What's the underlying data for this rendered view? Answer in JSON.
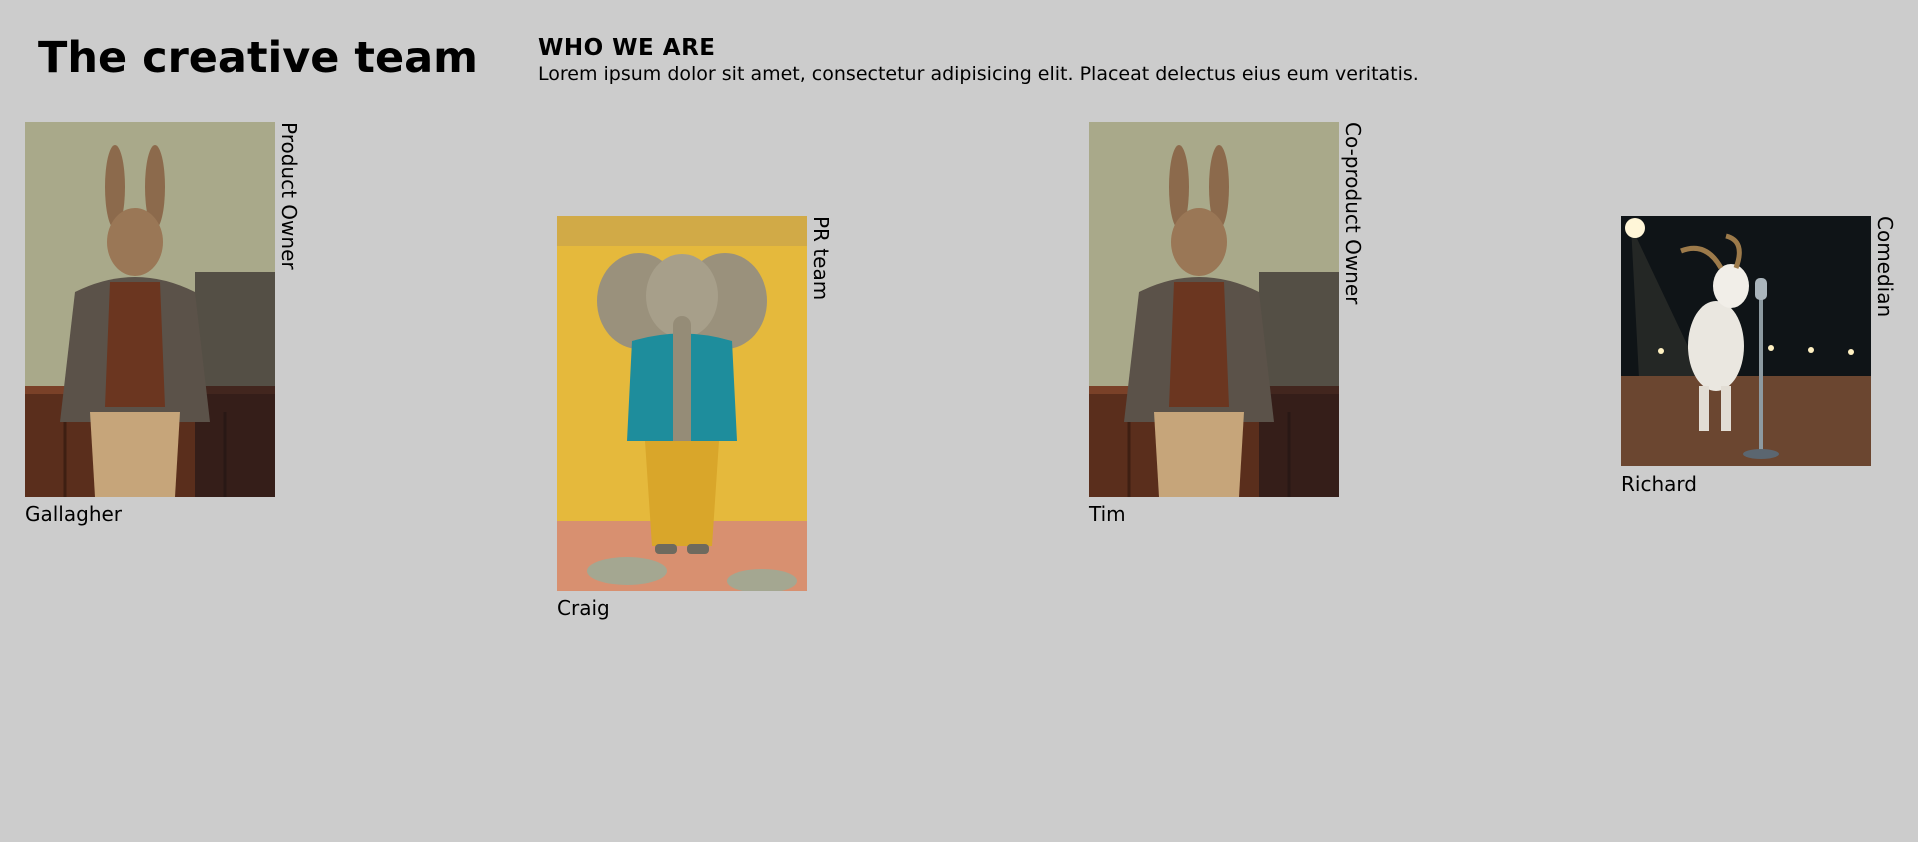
{
  "header": {
    "title": "The creative team",
    "intro_heading": "WHO WE ARE",
    "intro_text": "Lorem ipsum dolor sit amet, consectetur adipisicing elit. Placeat delectus eius eum veritatis."
  },
  "members": [
    {
      "name": "Gallagher",
      "role": "Product Owner",
      "photo_icon": "rabbit-in-suit-icon"
    },
    {
      "name": "Craig",
      "role": "PR team",
      "photo_icon": "elephant-in-sweater-icon"
    },
    {
      "name": "Tim",
      "role": "Co-product Owner",
      "photo_icon": "rabbit-in-suit-icon"
    },
    {
      "name": "Richard",
      "role": "Comedian",
      "photo_icon": "goat-at-microphone-icon"
    }
  ],
  "colors": {
    "page_background": "#cccccc",
    "text": "#000000"
  }
}
